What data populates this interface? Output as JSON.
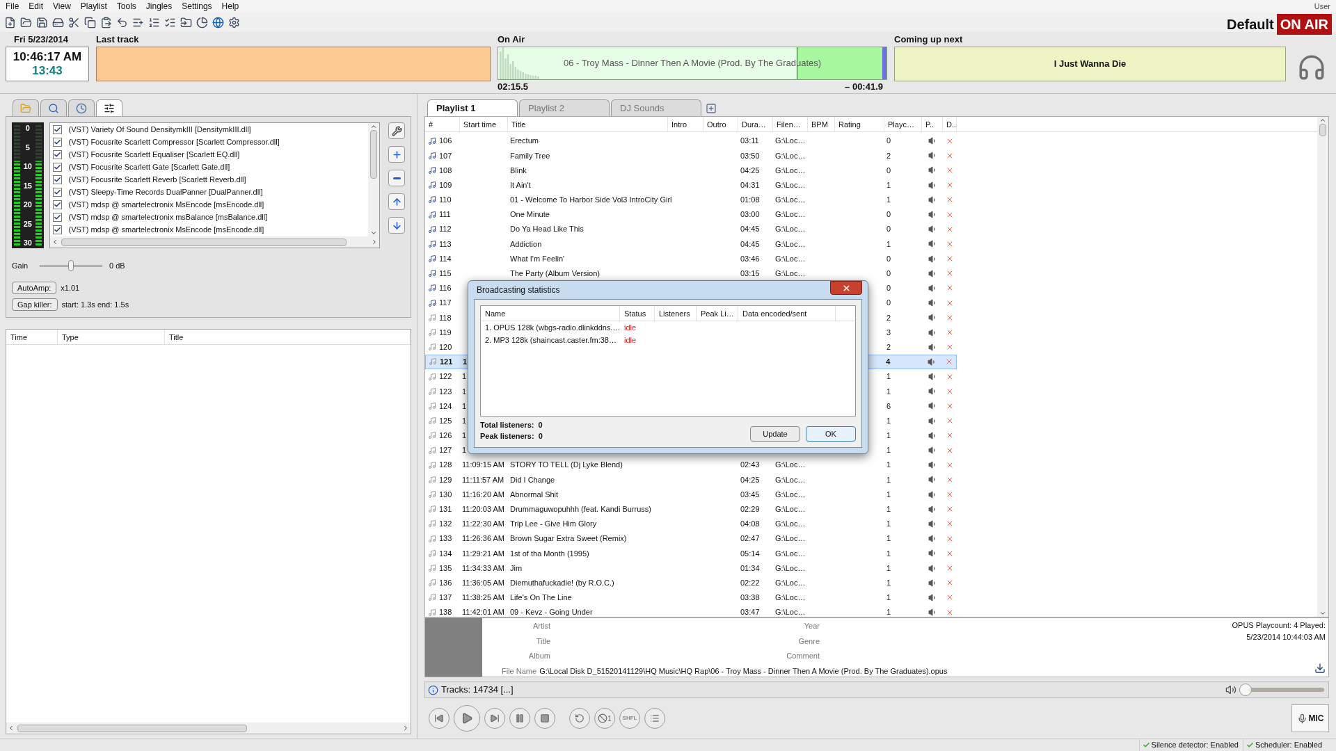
{
  "menu": [
    "File",
    "Edit",
    "View",
    "Playlist",
    "Tools",
    "Jingles",
    "Settings",
    "Help"
  ],
  "user": "User",
  "profile": {
    "name": "Default",
    "on_air": "ON AIR"
  },
  "clock": {
    "date": "Fri 5/23/2014",
    "time": "10:46:17 AM",
    "countdown": "13:43"
  },
  "last_track": {
    "label": "Last track"
  },
  "on_air": {
    "label": "On Air",
    "title": "06 - Troy Mass - Dinner Then A Movie (Prod. By The Graduates)",
    "level": 0.77,
    "elapsed": "02:15.5",
    "remaining": "– 00:41.9"
  },
  "next": {
    "label": "Coming up next",
    "title": "I Just Wanna Die"
  },
  "left_tabs": [
    {
      "kind": "folder",
      "selected": false
    },
    {
      "kind": "search",
      "selected": false
    },
    {
      "kind": "clock",
      "selected": false
    },
    {
      "kind": "mixer",
      "selected": true
    }
  ],
  "meter": {
    "scale": [
      "0",
      "5",
      "10",
      "15",
      "20",
      "25",
      "30"
    ],
    "channels": [
      {
        "level": 0.7
      },
      {
        "level": 0.7
      }
    ]
  },
  "plugins": [
    {
      "name": "(VST) Variety Of Sound DensitymkIII [DensitymkIII.dll]",
      "checked": true
    },
    {
      "name": "(VST) Focusrite Scarlett Compressor [Scarlett Compressor.dll]",
      "checked": true
    },
    {
      "name": "(VST) Focusrite Scarlett Equaliser [Scarlett EQ.dll]",
      "checked": true
    },
    {
      "name": "(VST) Focusrite Scarlett Gate [Scarlett Gate.dll]",
      "checked": true
    },
    {
      "name": "(VST) Focusrite Scarlett Reverb [Scarlett Reverb.dll]",
      "checked": true
    },
    {
      "name": "(VST) Sleepy-Time Records DualPanner [DualPanner.dll]",
      "checked": true
    },
    {
      "name": "(VST) mdsp @ smartelectronix MsEncode [msEncode.dll]",
      "checked": true
    },
    {
      "name": "(VST) mdsp @ smartelectronix msBalance [msBalance.dll]",
      "checked": true
    },
    {
      "name": "(VST) mdsp @ smartelectronix MsEncode [msEncode.dll]",
      "checked": true
    }
  ],
  "gain": {
    "label": "Gain",
    "level": 0.5,
    "reading": "0 dB"
  },
  "autoamp": {
    "button": "AutoAmp:",
    "value": "x1.01"
  },
  "gap_killer": {
    "button": "Gap killer:",
    "value": "start: 1.3s end: 1.5s"
  },
  "history": {
    "columns": [
      "Time",
      "Type",
      "Title"
    ]
  },
  "playlist_tabs": [
    {
      "label": "Playlist 1",
      "selected": true
    },
    {
      "label": "Playlist 2",
      "selected": false
    },
    {
      "label": "DJ Sounds",
      "selected": false
    }
  ],
  "columns": [
    "#",
    "Start time",
    "Title",
    "Intro",
    "Outro",
    "Dura…",
    "Filen…",
    "BPM",
    "Rating",
    "Playc…",
    "P..",
    "D.."
  ],
  "rows": [
    {
      "num": "106",
      "title": "Erectum",
      "duration": "03:11",
      "file": "G:\\Loc…",
      "playcount": "0",
      "queued": true,
      "selected": false
    },
    {
      "num": "107",
      "title": "Family Tree",
      "duration": "03:50",
      "file": "G:\\Loc…",
      "playcount": "2",
      "queued": true,
      "selected": false
    },
    {
      "num": "108",
      "title": "Blink",
      "duration": "04:25",
      "file": "G:\\Loc…",
      "playcount": "0",
      "queued": true,
      "selected": false
    },
    {
      "num": "109",
      "title": "It Ain't",
      "duration": "04:31",
      "file": "G:\\Loc…",
      "playcount": "1",
      "queued": true,
      "selected": false
    },
    {
      "num": "110",
      "title": "01 - Welcome To Harbor Side Vol3 IntroCity Girl",
      "duration": "01:08",
      "file": "G:\\Loc…",
      "playcount": "1",
      "queued": true,
      "selected": false
    },
    {
      "num": "111",
      "title": "One Minute",
      "duration": "03:00",
      "file": "G:\\Loc…",
      "playcount": "0",
      "queued": true,
      "selected": false
    },
    {
      "num": "112",
      "title": "Do Ya Head Like This",
      "duration": "04:45",
      "file": "G:\\Loc…",
      "playcount": "0",
      "queued": true,
      "selected": false
    },
    {
      "num": "113",
      "title": "Addiction",
      "duration": "04:45",
      "file": "G:\\Loc…",
      "playcount": "1",
      "queued": true,
      "selected": false
    },
    {
      "num": "114",
      "title": "What I'm Feelin'",
      "duration": "03:46",
      "file": "G:\\Loc…",
      "playcount": "0",
      "queued": true,
      "selected": false
    },
    {
      "num": "115",
      "title": "The Party (Album Version)",
      "duration": "03:15",
      "file": "G:\\Loc…",
      "playcount": "0",
      "queued": true,
      "selected": false
    },
    {
      "num": "116",
      "playcount": "0",
      "queued": true,
      "selected": false
    },
    {
      "num": "117",
      "playcount": "0",
      "queued": true,
      "selected": false
    },
    {
      "num": "118",
      "playcount": "2",
      "queued": false,
      "selected": false
    },
    {
      "num": "119",
      "playcount": "3",
      "queued": false,
      "selected": false
    },
    {
      "num": "120",
      "playcount": "2",
      "queued": false,
      "selected": false
    },
    {
      "num": "121",
      "start": "1",
      "playcount": "4",
      "queued": false,
      "selected": true
    },
    {
      "num": "122",
      "start": "1",
      "playcount": "1",
      "queued": false,
      "selected": false
    },
    {
      "num": "123",
      "start": "1",
      "playcount": "1",
      "queued": false,
      "selected": false
    },
    {
      "num": "124",
      "start": "1",
      "playcount": "6",
      "queued": false,
      "selected": false
    },
    {
      "num": "125",
      "start": "1",
      "playcount": "1",
      "queued": false,
      "selected": false
    },
    {
      "num": "126",
      "start": "1",
      "playcount": "1",
      "queued": false,
      "selected": false
    },
    {
      "num": "127",
      "start": "1",
      "playcount": "1",
      "queued": false,
      "selected": false
    },
    {
      "num": "128",
      "start": "11:09:15 AM",
      "title": "STORY TO TELL (Dj Lyke Blend)",
      "duration": "02:43",
      "file": "G:\\Loc…",
      "playcount": "1",
      "queued": false,
      "selected": false
    },
    {
      "num": "129",
      "start": "11:11:57 AM",
      "title": "Did I Change",
      "duration": "04:25",
      "file": "G:\\Loc…",
      "playcount": "1",
      "queued": false,
      "selected": false
    },
    {
      "num": "130",
      "start": "11:16:20 AM",
      "title": "Abnormal Shit",
      "duration": "03:45",
      "file": "G:\\Loc…",
      "playcount": "1",
      "queued": false,
      "selected": false
    },
    {
      "num": "131",
      "start": "11:20:03 AM",
      "title": "Drummaguwopuhhh (feat. Kandi Burruss)",
      "duration": "02:29",
      "file": "G:\\Loc…",
      "playcount": "1",
      "queued": false,
      "selected": false
    },
    {
      "num": "132",
      "start": "11:22:30 AM",
      "title": "Trip Lee - Give Him Glory",
      "duration": "04:08",
      "file": "G:\\Loc…",
      "playcount": "1",
      "queued": false,
      "selected": false
    },
    {
      "num": "133",
      "start": "11:26:36 AM",
      "title": "Brown Sugar Extra Sweet (Remix)",
      "duration": "02:47",
      "file": "G:\\Loc…",
      "playcount": "1",
      "queued": false,
      "selected": false
    },
    {
      "num": "134",
      "start": "11:29:21 AM",
      "title": "1st of tha Month (1995)",
      "duration": "05:14",
      "file": "G:\\Loc…",
      "playcount": "1",
      "queued": false,
      "selected": false
    },
    {
      "num": "135",
      "start": "11:34:33 AM",
      "title": "Jim",
      "duration": "01:34",
      "file": "G:\\Loc…",
      "playcount": "1",
      "queued": false,
      "selected": false
    },
    {
      "num": "136",
      "start": "11:36:05 AM",
      "title": "Diemuthafuckadie! (by R.O.C.)",
      "duration": "02:22",
      "file": "G:\\Loc…",
      "playcount": "1",
      "queued": false,
      "selected": false
    },
    {
      "num": "137",
      "start": "11:38:25 AM",
      "title": "Life's On The Line",
      "duration": "03:38",
      "file": "G:\\Loc…",
      "playcount": "1",
      "queued": false,
      "selected": false
    },
    {
      "num": "138",
      "start": "11:42:01 AM",
      "title": "09 - Kevz - Going Under",
      "duration": "03:47",
      "file": "G:\\Loc…",
      "playcount": "1",
      "queued": false,
      "selected": false
    }
  ],
  "info": {
    "labels_left": [
      "Artist",
      "Title",
      "Album"
    ],
    "labels_right": [
      "Year",
      "Genre",
      "Comment"
    ],
    "file_label": "File Name",
    "file_value": "G:\\Local Disk D_51520141129\\HQ Music\\HQ Rap\\06 - Troy Mass - Dinner Then A Movie (Prod. By The Graduates).opus",
    "note": [
      "OPUS Playcount: 4 Played:",
      "5/23/2014 10:44:03 AM"
    ]
  },
  "tracks": {
    "text": "Tracks: 14734 [...]",
    "volume": {
      "level": 0.02
    }
  },
  "transport": {
    "stop_after": "1",
    "shuffle": "SHFL",
    "mic": "MIC"
  },
  "status_bar": [
    "Silence detector: Enabled",
    "Scheduler: Enabled"
  ],
  "dialog": {
    "title": "Broadcasting statistics",
    "columns": [
      "Name",
      "Status",
      "Listeners",
      "Peak Li…",
      "Data encoded/sent"
    ],
    "rows": [
      {
        "name": "1. OPUS 128k (wbgs-radio.dlinkddns.…",
        "status": "idle"
      },
      {
        "name": "2. MP3 128k (shaincast.caster.fm:38…",
        "status": "idle"
      }
    ],
    "totals": [
      "Total listeners:  0",
      "Peak listeners:  0"
    ],
    "buttons": [
      "Update",
      "OK"
    ]
  }
}
